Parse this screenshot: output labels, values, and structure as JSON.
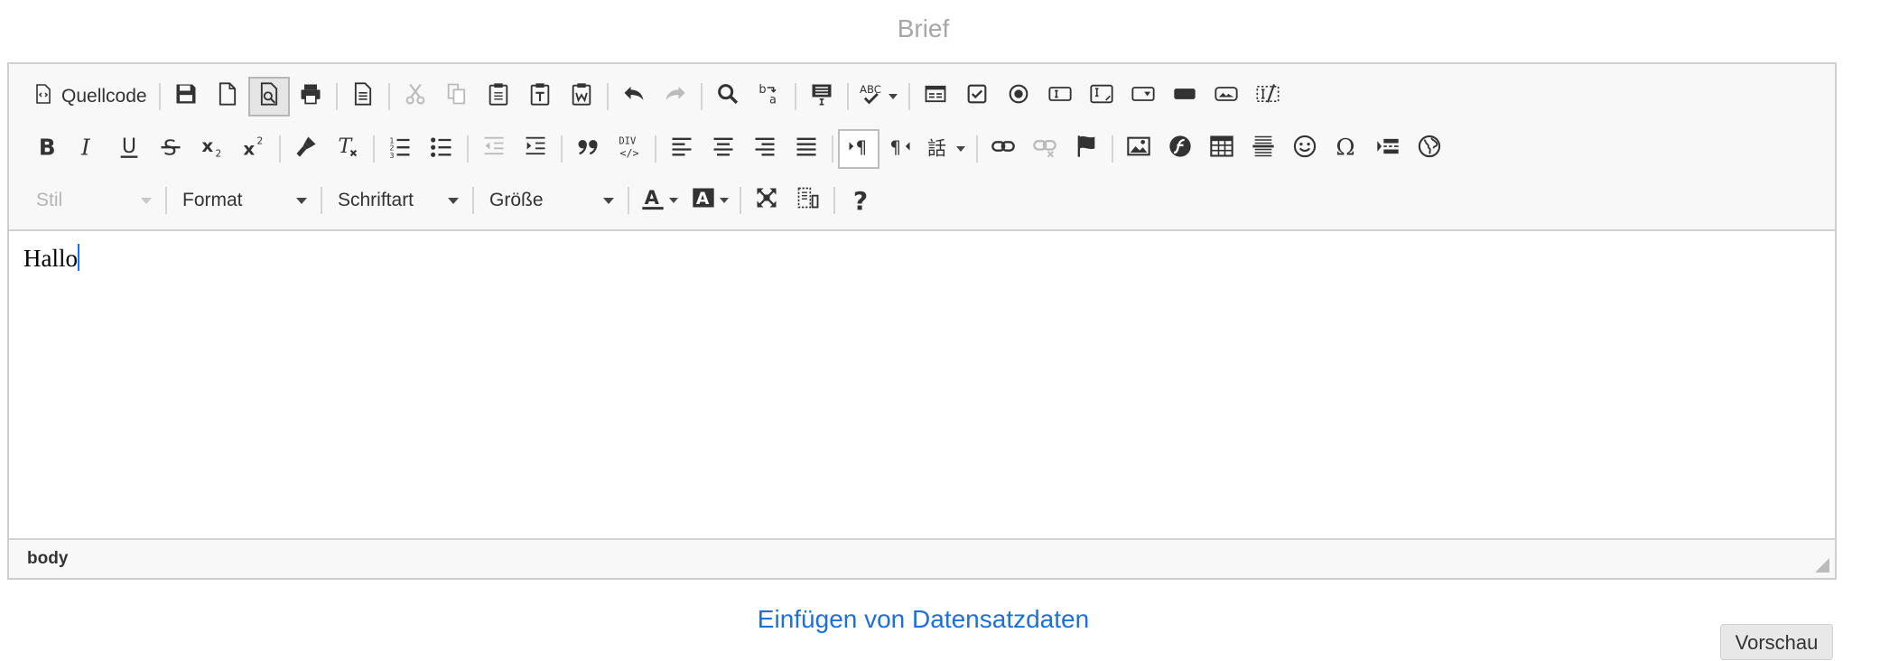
{
  "page": {
    "title": "Brief",
    "insert_link": "Einfügen von Datensatzdaten",
    "preview_button": "Vorschau"
  },
  "toolbar": {
    "source_label": "Quellcode",
    "style_combo": "Stil",
    "format_combo": "Format",
    "font_combo": "Schriftart",
    "size_combo": "Größe",
    "help_label": "?"
  },
  "editor": {
    "content": "Hallo",
    "element_path": "body"
  },
  "colors": {
    "link": "#1f6fd6",
    "cursor": "#1a6ef5",
    "toolbar_bg": "#f8f8f8"
  }
}
